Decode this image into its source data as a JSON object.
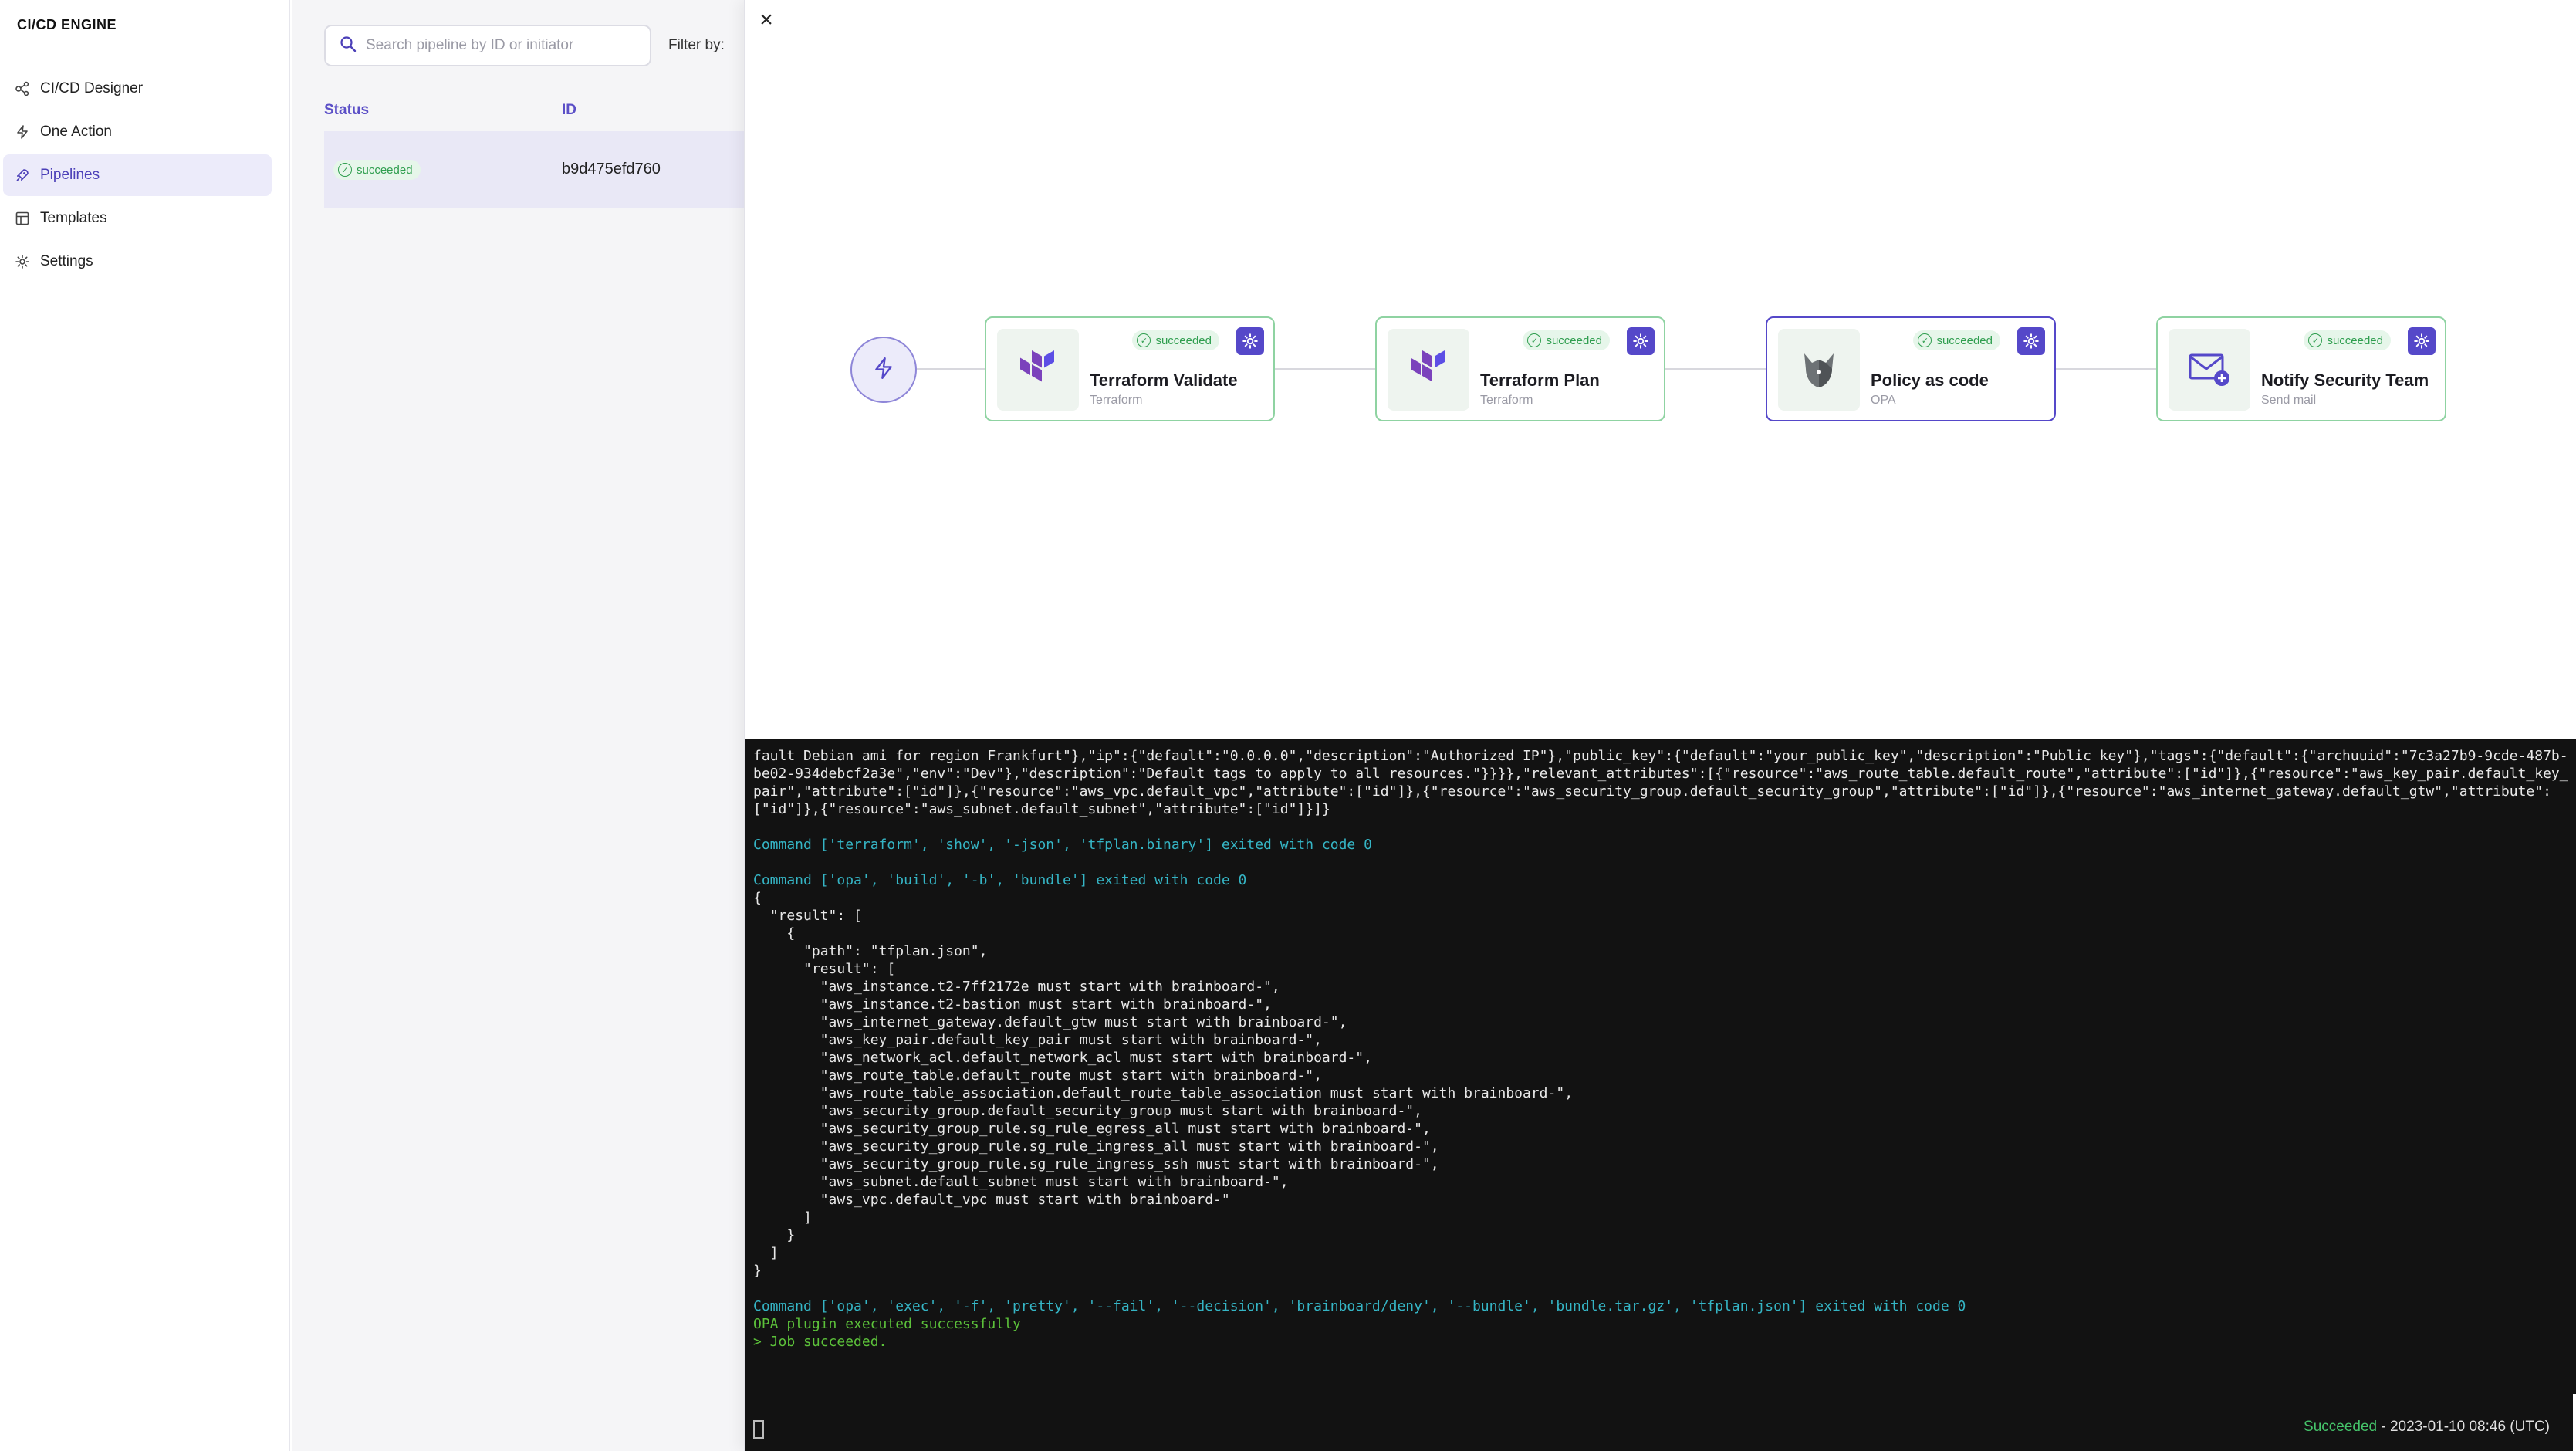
{
  "app": {
    "brand": "CI/CD ENGINE"
  },
  "sidebar": {
    "items": [
      {
        "label": "CI/CD Designer",
        "icon": "designer-icon",
        "active": false
      },
      {
        "label": "One Action",
        "icon": "lightning-icon",
        "active": false
      },
      {
        "label": "Pipelines",
        "icon": "rocket-icon",
        "active": true
      },
      {
        "label": "Templates",
        "icon": "templates-icon",
        "active": false
      },
      {
        "label": "Settings",
        "icon": "gear-icon",
        "active": false
      }
    ]
  },
  "list": {
    "search_placeholder": "Search pipeline by ID or initiator",
    "filter_label": "Filter by:",
    "columns": {
      "status": "Status",
      "id": "ID"
    },
    "rows": [
      {
        "status": "succeeded",
        "id": "b9d475efd760"
      }
    ]
  },
  "detail": {
    "close": "×",
    "nodes": [
      {
        "name": "Terraform Validate",
        "sub": "Terraform",
        "status": "succeeded",
        "logo": "terraform-logo-icon"
      },
      {
        "name": "Terraform Plan",
        "sub": "Terraform",
        "status": "succeeded",
        "logo": "terraform-logo-icon"
      },
      {
        "name": "Policy as code",
        "sub": "OPA",
        "status": "succeeded",
        "logo": "opa-logo-icon"
      },
      {
        "name": "Notify Security Team",
        "sub": "Send mail",
        "status": "succeeded",
        "logo": "mail-icon"
      }
    ],
    "terminal": {
      "lines": [
        {
          "type": "plain",
          "text": "fault Debian ami for region Frankfurt\"},\"ip\":{\"default\":\"0.0.0.0\",\"description\":\"Authorized IP\"},\"public_key\":{\"default\":\"your_public_key\",\"description\":\"Public key\"},\"tags\":{\"default\":{\"archuuid\":\"7c3a27b9-9cde-487b-be02-934debcf2a3e\",\"env\":\"Dev\"},\"description\":\"Default tags to apply to all resources.\"}}}},\"relevant_attributes\":[{\"resource\":\"aws_route_table.default_route\",\"attribute\":[\"id\"]},{\"resource\":\"aws_key_pair.default_key_pair\",\"attribute\":[\"id\"]},{\"resource\":\"aws_vpc.default_vpc\",\"attribute\":[\"id\"]},{\"resource\":\"aws_security_group.default_security_group\",\"attribute\":[\"id\"]},{\"resource\":\"aws_internet_gateway.default_gtw\",\"attribute\":[\"id\"]},{\"resource\":\"aws_subnet.default_subnet\",\"attribute\":[\"id\"]}]}"
        },
        {
          "type": "plain",
          "text": ""
        },
        {
          "type": "cmd",
          "text": "Command ['terraform', 'show', '-json', 'tfplan.binary'] exited with code 0"
        },
        {
          "type": "plain",
          "text": ""
        },
        {
          "type": "cmd",
          "text": "Command ['opa', 'build', '-b', 'bundle'] exited with code 0"
        },
        {
          "type": "plain",
          "text": "{"
        },
        {
          "type": "plain",
          "text": "  \"result\": ["
        },
        {
          "type": "plain",
          "text": "    {"
        },
        {
          "type": "plain",
          "text": "      \"path\": \"tfplan.json\","
        },
        {
          "type": "plain",
          "text": "      \"result\": ["
        },
        {
          "type": "plain",
          "text": "        \"aws_instance.t2-7ff2172e must start with brainboard-\","
        },
        {
          "type": "plain",
          "text": "        \"aws_instance.t2-bastion must start with brainboard-\","
        },
        {
          "type": "plain",
          "text": "        \"aws_internet_gateway.default_gtw must start with brainboard-\","
        },
        {
          "type": "plain",
          "text": "        \"aws_key_pair.default_key_pair must start with brainboard-\","
        },
        {
          "type": "plain",
          "text": "        \"aws_network_acl.default_network_acl must start with brainboard-\","
        },
        {
          "type": "plain",
          "text": "        \"aws_route_table.default_route must start with brainboard-\","
        },
        {
          "type": "plain",
          "text": "        \"aws_route_table_association.default_route_table_association must start with brainboard-\","
        },
        {
          "type": "plain",
          "text": "        \"aws_security_group.default_security_group must start with brainboard-\","
        },
        {
          "type": "plain",
          "text": "        \"aws_security_group_rule.sg_rule_egress_all must start with brainboard-\","
        },
        {
          "type": "plain",
          "text": "        \"aws_security_group_rule.sg_rule_ingress_all must start with brainboard-\","
        },
        {
          "type": "plain",
          "text": "        \"aws_security_group_rule.sg_rule_ingress_ssh must start with brainboard-\","
        },
        {
          "type": "plain",
          "text": "        \"aws_subnet.default_subnet must start with brainboard-\","
        },
        {
          "type": "plain",
          "text": "        \"aws_vpc.default_vpc must start with brainboard-\""
        },
        {
          "type": "plain",
          "text": "      ]"
        },
        {
          "type": "plain",
          "text": "    }"
        },
        {
          "type": "plain",
          "text": "  ]"
        },
        {
          "type": "plain",
          "text": "}"
        },
        {
          "type": "plain",
          "text": ""
        },
        {
          "type": "cmd",
          "text": "Command ['opa', 'exec', '-f', 'pretty', '--fail', '--decision', 'brainboard/deny', '--bundle', 'bundle.tar.gz', 'tfplan.json'] exited with code 0"
        },
        {
          "type": "ok",
          "text": "OPA plugin executed successfully"
        },
        {
          "type": "ok",
          "text": "> Job succeeded."
        }
      ],
      "status": "Succeeded",
      "timestamp": " - 2023-01-10 08:46 (UTC)"
    }
  },
  "colors": {
    "accent": "#5548c9",
    "success": "#2f9e4f",
    "terminal_bg": "#121212"
  }
}
